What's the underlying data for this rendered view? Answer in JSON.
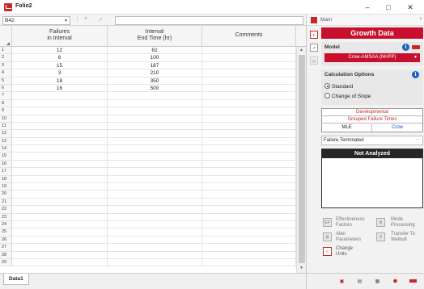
{
  "window": {
    "title": "Folio2",
    "minimize": "–",
    "maximize": "□",
    "close": "✕"
  },
  "formula_bar": {
    "cell_ref": "B42",
    "cancel": "×",
    "confirm": "✓",
    "formula_value": ""
  },
  "grid": {
    "columns": [
      {
        "line1": "Failures",
        "line2": "in Interval"
      },
      {
        "line1": "Interval",
        "line2": "End Time (hr)"
      },
      {
        "line1": "Comments",
        "line2": ""
      }
    ],
    "rows": [
      {
        "n": "1",
        "failures": "12",
        "end_time": "62",
        "comment": ""
      },
      {
        "n": "2",
        "failures": "6",
        "end_time": "100",
        "comment": ""
      },
      {
        "n": "3",
        "failures": "15",
        "end_time": "187",
        "comment": ""
      },
      {
        "n": "4",
        "failures": "3",
        "end_time": "210",
        "comment": ""
      },
      {
        "n": "5",
        "failures": "18",
        "end_time": "350",
        "comment": ""
      },
      {
        "n": "6",
        "failures": "16",
        "end_time": "500",
        "comment": ""
      },
      {
        "n": "7",
        "failures": "",
        "end_time": "",
        "comment": ""
      },
      {
        "n": "8",
        "failures": "",
        "end_time": "",
        "comment": ""
      },
      {
        "n": "9",
        "failures": "",
        "end_time": "",
        "comment": ""
      },
      {
        "n": "10",
        "failures": "",
        "end_time": "",
        "comment": ""
      },
      {
        "n": "11",
        "failures": "",
        "end_time": "",
        "comment": ""
      },
      {
        "n": "12",
        "failures": "",
        "end_time": "",
        "comment": ""
      },
      {
        "n": "13",
        "failures": "",
        "end_time": "",
        "comment": ""
      },
      {
        "n": "14",
        "failures": "",
        "end_time": "",
        "comment": ""
      },
      {
        "n": "15",
        "failures": "",
        "end_time": "",
        "comment": ""
      },
      {
        "n": "16",
        "failures": "",
        "end_time": "",
        "comment": ""
      },
      {
        "n": "17",
        "failures": "",
        "end_time": "",
        "comment": ""
      },
      {
        "n": "18",
        "failures": "",
        "end_time": "",
        "comment": ""
      },
      {
        "n": "19",
        "failures": "",
        "end_time": "",
        "comment": ""
      },
      {
        "n": "20",
        "failures": "",
        "end_time": "",
        "comment": ""
      },
      {
        "n": "21",
        "failures": "",
        "end_time": "",
        "comment": ""
      },
      {
        "n": "22",
        "failures": "",
        "end_time": "",
        "comment": ""
      },
      {
        "n": "23",
        "failures": "",
        "end_time": "",
        "comment": ""
      },
      {
        "n": "24",
        "failures": "",
        "end_time": "",
        "comment": ""
      },
      {
        "n": "25",
        "failures": "",
        "end_time": "",
        "comment": ""
      },
      {
        "n": "26",
        "failures": "",
        "end_time": "",
        "comment": ""
      },
      {
        "n": "27",
        "failures": "",
        "end_time": "",
        "comment": ""
      },
      {
        "n": "28",
        "failures": "",
        "end_time": "",
        "comment": ""
      },
      {
        "n": "29",
        "failures": "",
        "end_time": "",
        "comment": ""
      }
    ]
  },
  "sheet_tabs": [
    "Data1"
  ],
  "panel": {
    "header_label": "Main",
    "collapse": "›",
    "title": "Growth Data",
    "model": {
      "title": "Model",
      "selected": "Crow-AMSAA (NHPP)"
    },
    "calc_options": {
      "title": "Calculation Options",
      "options": [
        "Standard",
        "Change of Slope"
      ],
      "selected": "Standard"
    },
    "data_type": {
      "line1": "Developmental",
      "line2": "Grouped Failure Times",
      "method": "MLE",
      "model": "Crow"
    },
    "termination": "Failure Terminated",
    "status": "Not Analyzed",
    "tools": {
      "effectiveness": "Effectiveness Factors",
      "mode_processing": "Mode Processing",
      "alter_parameters": "Alter Parameters",
      "transfer_weibull": "Transfer To Weibull",
      "change_units": "Change Units"
    }
  },
  "colors": {
    "accent_red": "#c8102e",
    "info_blue": "#1565c0",
    "crow_blue": "#1a4fd6",
    "status_black": "#262626"
  }
}
